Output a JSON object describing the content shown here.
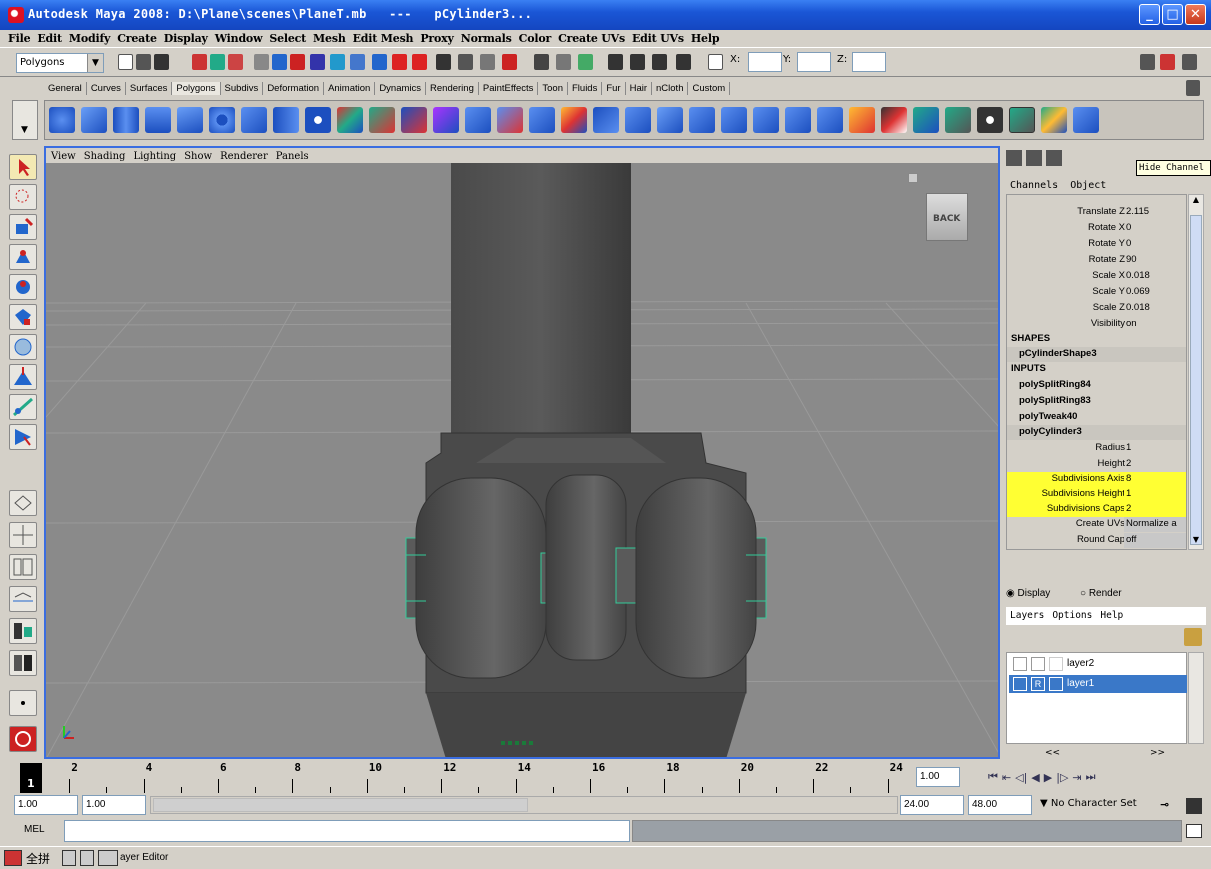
{
  "window": {
    "title": "Autodesk Maya 2008: D:\\Plane\\scenes\\PlaneT.mb   ---   pCylinder3...",
    "minimize": "_",
    "maximize": "□",
    "close": "✕"
  },
  "menubar": [
    "File",
    "Edit",
    "Modify",
    "Create",
    "Display",
    "Window",
    "Select",
    "Mesh",
    "Edit Mesh",
    "Proxy",
    "Normals",
    "Color",
    "Create UVs",
    "Edit UVs",
    "Help"
  ],
  "statusline": {
    "mode": "Polygons",
    "x_label": "X:",
    "y_label": "Y:",
    "z_label": "Z:"
  },
  "shelf_tabs": [
    "General",
    "Curves",
    "Surfaces",
    "Polygons",
    "Subdivs",
    "Deformation",
    "Animation",
    "Dynamics",
    "Rendering",
    "PaintEffects",
    "Toon",
    "Fluids",
    "Fur",
    "Hair",
    "nCloth",
    "Custom"
  ],
  "shelf_active": "Polygons",
  "viewport": {
    "menu": [
      "View",
      "Shading",
      "Lighting",
      "Show",
      "Renderer",
      "Panels"
    ],
    "viewcube_label": "BACK"
  },
  "channel_box": {
    "tooltip": "Hide Channel",
    "menu_channels": "Channels",
    "menu_object": "Object",
    "attributes": [
      {
        "label": "Translate Z",
        "value": "2.115"
      },
      {
        "label": "Rotate X",
        "value": "0"
      },
      {
        "label": "Rotate Y",
        "value": "0"
      },
      {
        "label": "Rotate Z",
        "value": "90"
      },
      {
        "label": "Scale X",
        "value": "0.018"
      },
      {
        "label": "Scale Y",
        "value": "0.069"
      },
      {
        "label": "Scale Z",
        "value": "0.018"
      },
      {
        "label": "Visibility",
        "value": "on"
      }
    ],
    "shapes_header": "SHAPES",
    "shape_node": "pCylinderShape3",
    "inputs_header": "INPUTS",
    "input_nodes": [
      "polySplitRing84",
      "polySplitRing83",
      "polyTweak40",
      "polyCylinder3"
    ],
    "cylinder_attrs": [
      {
        "label": "Radius",
        "value": "1"
      },
      {
        "label": "Height",
        "value": "2"
      },
      {
        "label": "Subdivisions Axis",
        "value": "8"
      },
      {
        "label": "Subdivisions Height",
        "value": "1"
      },
      {
        "label": "Subdivisions Caps",
        "value": "2"
      },
      {
        "label": "Create UVs",
        "value": "Normalize a"
      },
      {
        "label": "Round Cap",
        "value": "off"
      }
    ]
  },
  "layer_editor": {
    "display_label": "Display",
    "render_label": "Render",
    "menu": [
      "Layers",
      "Options",
      "Help"
    ],
    "layers": [
      {
        "name": "layer2",
        "r": "",
        "selected": false
      },
      {
        "name": "layer1",
        "r": "R",
        "selected": true
      }
    ],
    "nav_left": "<<",
    "nav_right": ">>"
  },
  "timeslider": {
    "current_frame": "1",
    "tick_labels": [
      "2",
      "4",
      "6",
      "8",
      "10",
      "12",
      "14",
      "16",
      "18",
      "20",
      "22",
      "24"
    ],
    "current_time_field": "1.00"
  },
  "range": {
    "start": "1.00",
    "playback_start": "1.00",
    "playback_end": "24.00",
    "end": "48.00",
    "character_set": "No Character Set"
  },
  "mel": {
    "label": "MEL"
  },
  "helpline": {
    "ime": "全拼",
    "text": "ayer Editor"
  },
  "colors": {
    "titlebar": "#1a56d6",
    "highlight": "#ffff33",
    "selection": "#3a78c8",
    "viewport_bg": "#8a8a8a"
  }
}
